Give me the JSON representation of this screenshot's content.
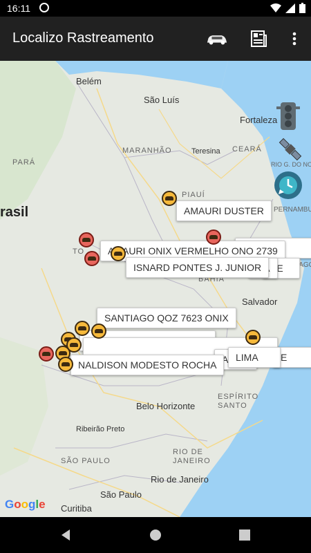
{
  "status": {
    "time": "16:11"
  },
  "app_bar": {
    "title": "Localizo Rastreamento"
  },
  "map": {
    "cities": [
      "Belém",
      "São Luís",
      "Fortaleza",
      "Teresina",
      "Salvador",
      "Belo Horizonte",
      "Ribeirão Preto",
      "Rio de Janeiro",
      "São Paulo",
      "Curitiba"
    ],
    "states": [
      "MARANHÃO",
      "CEARÁ",
      "PARÁ",
      "PIAUÍ",
      "TO",
      "BAHIA",
      "ESPÍRITO SANTO",
      "SÃO PAULO",
      "RIO DE JANEIRO",
      "RIO G. DO NORTE",
      "PERNAMBUCO",
      "ALAGOAS"
    ],
    "country": "rasil",
    "callouts": [
      "AMAURI DUSTER",
      "AMAURI ONIX VERMELHO ONO 2739",
      "ISNARD PONTES J. JUNIOR",
      "SANTIAGO QOZ 7623 ONIX",
      "NALDISON MODESTO ROCHA",
      "LIMA",
      "ARES",
      "RA",
      "PE",
      "A",
      "E"
    ],
    "google": "Google"
  }
}
